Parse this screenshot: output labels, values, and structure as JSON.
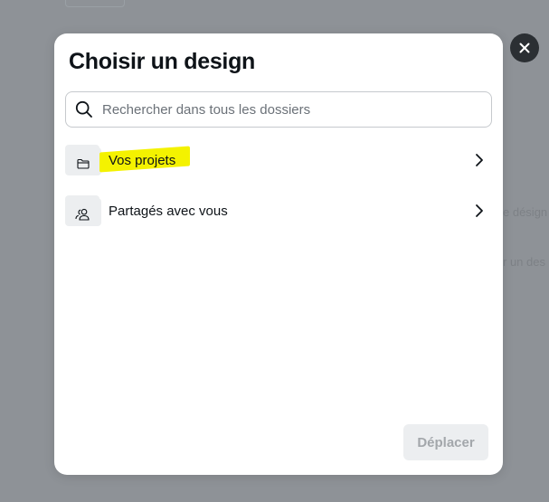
{
  "dialog": {
    "title": "Choisir un design",
    "search": {
      "placeholder": "Rechercher dans tous les dossiers",
      "value": ""
    },
    "folders": [
      {
        "label": "Vos projets",
        "icon": "folder-icon",
        "highlighted": true
      },
      {
        "label": "Partagés avec vous",
        "icon": "shared-users-icon",
        "highlighted": false
      }
    ],
    "move_button_label": "Déplacer",
    "move_button_enabled": false
  },
  "colors": {
    "overlay": "#8e9297",
    "close_button_bg": "#2b2f33",
    "highlight": "#f4f200",
    "disabled_button_bg": "#eceef0",
    "disabled_button_text": "#a3a7ab"
  },
  "background_hints": {
    "text_1": "e désign",
    "text_2": "r un des"
  }
}
